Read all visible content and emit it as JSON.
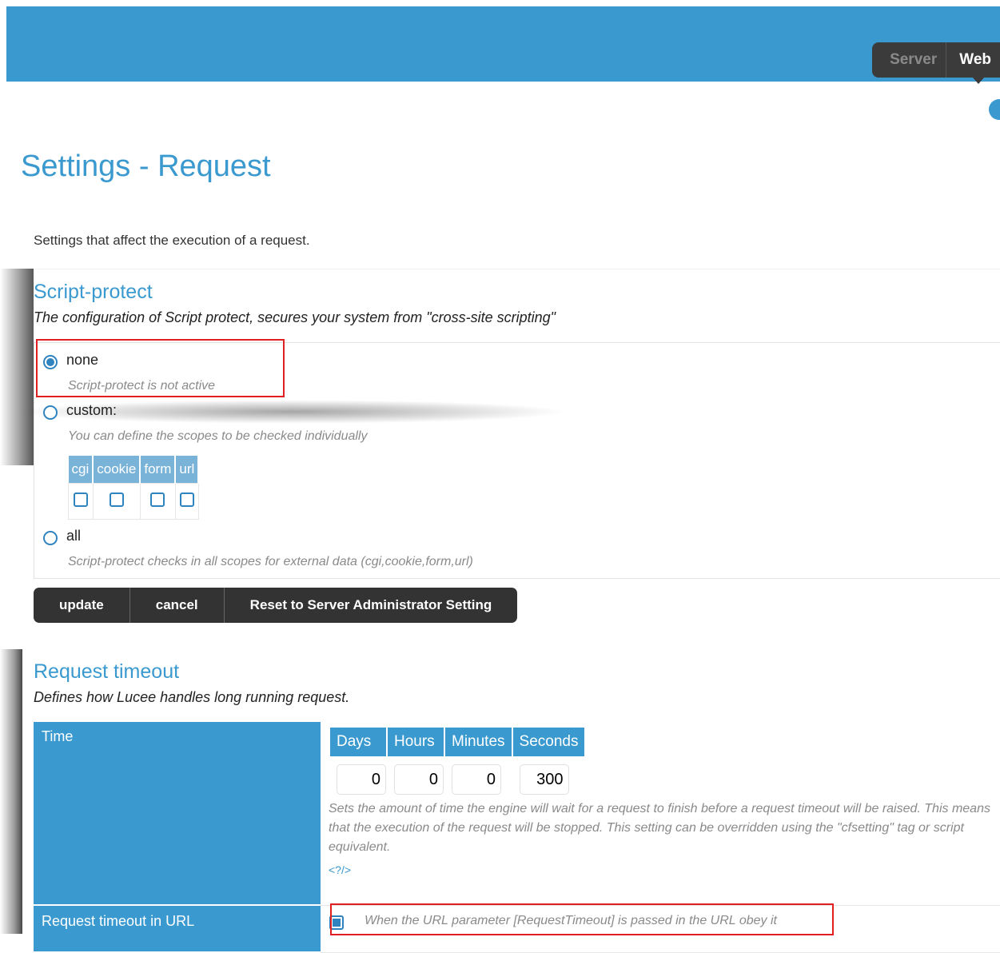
{
  "header": {
    "tabs": [
      {
        "label": "Server",
        "active": false
      },
      {
        "label": "Web",
        "active": true
      }
    ]
  },
  "page": {
    "title": "Settings - Request",
    "intro": "Settings that affect the execution of a request."
  },
  "script_protect": {
    "title": "Script-protect",
    "description": "The configuration of Script protect, secures your system from \"cross-site scripting\"",
    "options": [
      {
        "label": "none",
        "hint": "Script-protect is not active",
        "checked": true
      },
      {
        "label": "custom:",
        "hint": "You can define the scopes to be checked individually",
        "checked": false
      },
      {
        "label": "all",
        "hint": "Script-protect checks in all scopes for external data (cgi,cookie,form,url)",
        "checked": false
      }
    ],
    "scopes": [
      "cgi",
      "cookie",
      "form",
      "url"
    ]
  },
  "buttons": {
    "update": "update",
    "cancel": "cancel",
    "reset": "Reset to Server Administrator Setting"
  },
  "request_timeout": {
    "title": "Request timeout",
    "description": "Defines how Lucee handles long running request.",
    "time_label": "Time",
    "columns": [
      "Days",
      "Hours",
      "Minutes",
      "Seconds"
    ],
    "values": [
      "0",
      "0",
      "0",
      "300"
    ],
    "hint": "Sets the amount of time the engine will wait for a request to finish before a request timeout will be raised. This means that the execution of the request will be stopped. This setting can be overridden using the \"cfsetting\" tag or script equivalent.",
    "doc_link": "<?/>",
    "url_label": "Request timeout in URL",
    "url_hint": "When the URL parameter [RequestTimeout] is passed in the URL obey it",
    "url_checked": true
  },
  "colors": {
    "accent": "#3a99cf",
    "dark": "#333333",
    "highlight": "#e02020"
  }
}
